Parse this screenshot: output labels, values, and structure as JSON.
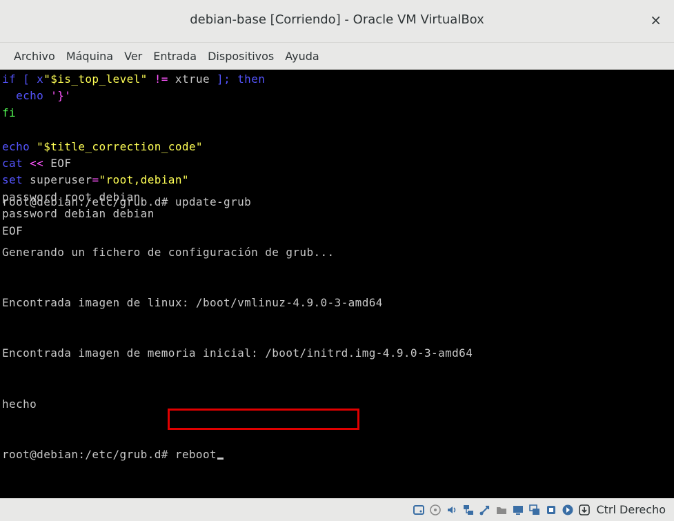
{
  "window": {
    "title": "debian-base [Corriendo] - Oracle VM VirtualBox",
    "close_glyph": "×"
  },
  "menu": {
    "items": [
      "Archivo",
      "Máquina",
      "Ver",
      "Entrada",
      "Dispositivos",
      "Ayuda"
    ]
  },
  "terminal": {
    "script_lines": [
      [
        {
          "t": "if [ x",
          "c": "blue"
        },
        {
          "t": "\"$is_top_level\"",
          "c": "yellow"
        },
        {
          "t": " != ",
          "c": "magenta"
        },
        {
          "t": "xtrue",
          "c": "white"
        },
        {
          "t": " ]; then",
          "c": "blue"
        }
      ],
      [
        {
          "t": "  echo ",
          "c": "blue"
        },
        {
          "t": "'}'",
          "c": "magenta"
        }
      ],
      [
        {
          "t": "fi",
          "c": "green"
        }
      ],
      [],
      [
        {
          "t": "echo ",
          "c": "blue"
        },
        {
          "t": "\"$title_correction_code\"",
          "c": "yellow"
        }
      ],
      [
        {
          "t": "cat ",
          "c": "blue"
        },
        {
          "t": "<< ",
          "c": "magenta"
        },
        {
          "t": "EOF",
          "c": "white"
        }
      ],
      [
        {
          "t": "set ",
          "c": "blue"
        },
        {
          "t": "superuser",
          "c": "white"
        },
        {
          "t": "=",
          "c": "magenta"
        },
        {
          "t": "\"root,debian\"",
          "c": "yellow"
        }
      ],
      [
        {
          "t": "password root debian",
          "c": "white"
        }
      ],
      [
        {
          "t": "password debian debian",
          "c": "white"
        }
      ],
      [
        {
          "t": "EOF",
          "c": "white"
        }
      ]
    ],
    "output_lines": [
      "root@debian:/etc/grub.d# update-grub",
      "Generando un fichero de configuración de grub...",
      "Encontrada imagen de linux: /boot/vmlinuz-4.9.0-3-amd64",
      "Encontrada imagen de memoria inicial: /boot/initrd.img-4.9.0-3-amd64",
      "hecho"
    ],
    "prompt": "root@debian:/etc/grub.d# ",
    "command": "reboot"
  },
  "colors": {
    "blue": "#5555ff",
    "yellow": "#ffff55",
    "magenta": "#ff55ff",
    "green": "#55ff55",
    "white": "#c8c8c8",
    "highlight": "#e00000"
  },
  "statusbar": {
    "icons": [
      {
        "name": "hard-disk-icon",
        "color": "#3a6ea5"
      },
      {
        "name": "optical-drive-icon",
        "color": "#8a8a8a"
      },
      {
        "name": "audio-icon",
        "color": "#3a6ea5"
      },
      {
        "name": "network-icon",
        "color": "#3a6ea5"
      },
      {
        "name": "usb-icon",
        "color": "#3a6ea5"
      },
      {
        "name": "shared-folders-icon",
        "color": "#8a8a8a"
      },
      {
        "name": "display-icon",
        "color": "#3a6ea5"
      },
      {
        "name": "video-capture-icon",
        "color": "#3a6ea5"
      },
      {
        "name": "cpu-icon",
        "color": "#3a6ea5"
      },
      {
        "name": "mouse-integration-icon",
        "color": "#3a6ea5"
      },
      {
        "name": "keyboard-capture-icon",
        "color": "#2e3436"
      }
    ],
    "host_key": "Ctrl Derecho"
  }
}
